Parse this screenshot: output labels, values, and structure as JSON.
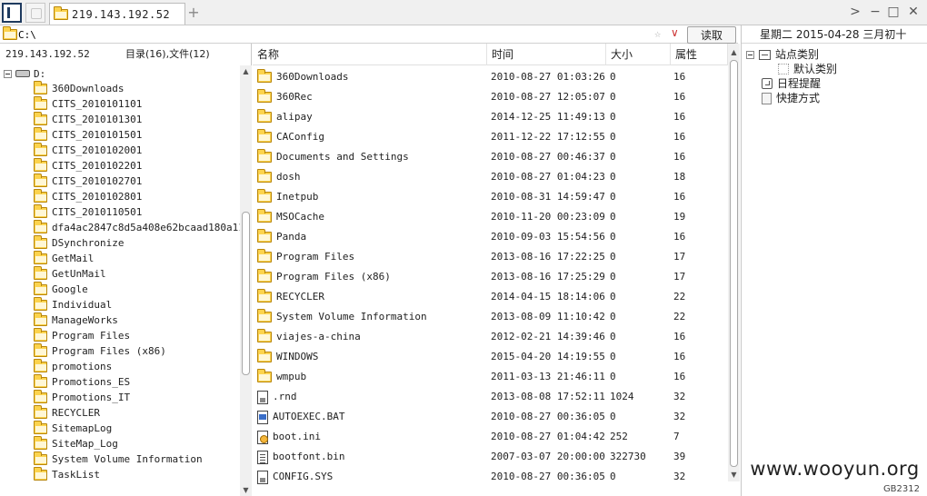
{
  "tabbar": {
    "tab_title": "219.143.192.52",
    "add_label": "+",
    "forward_label": ">",
    "minimize_label": "−",
    "maximize_label": "□",
    "close_label": "✕"
  },
  "address": {
    "value": "C:\\",
    "star_label": "☆",
    "dropdown_label": "∨",
    "read_button": "读取"
  },
  "left_panel": {
    "host": "219.143.192.52",
    "summary": "目录(16),文件(12)",
    "drive": "D:",
    "folders": [
      "360Downloads",
      "CITS_2010101101",
      "CITS_2010101301",
      "CITS_2010101501",
      "CITS_2010102001",
      "CITS_2010102201",
      "CITS_2010102701",
      "CITS_2010102801",
      "CITS_2010110501",
      "dfa4ac2847c8d5a408e62bcaad180a11",
      "DSynchronize",
      "GetMail",
      "GetUnMail",
      "Google",
      "Individual",
      "ManageWorks",
      "Program Files",
      "Program Files (x86)",
      "promotions",
      "Promotions_ES",
      "Promotions_IT",
      "RECYCLER",
      "SitemapLog",
      "SiteMap_Log",
      "System Volume Information",
      "TaskList"
    ]
  },
  "file_list": {
    "columns": {
      "name": "名称",
      "time": "时间",
      "size": "大小",
      "attr": "属性"
    },
    "rows": [
      {
        "name": "360Downloads",
        "time": "2010-08-27 01:03:26",
        "size": "0",
        "attr": "16",
        "icon": "folder-icon"
      },
      {
        "name": "360Rec",
        "time": "2010-08-27 12:05:07",
        "size": "0",
        "attr": "16",
        "icon": "folder-icon"
      },
      {
        "name": "alipay",
        "time": "2014-12-25 11:49:13",
        "size": "0",
        "attr": "16",
        "icon": "folder-icon"
      },
      {
        "name": "CAConfig",
        "time": "2011-12-22 17:12:55",
        "size": "0",
        "attr": "16",
        "icon": "folder-icon"
      },
      {
        "name": "Documents and Settings",
        "time": "2010-08-27 00:46:37",
        "size": "0",
        "attr": "16",
        "icon": "folder-icon"
      },
      {
        "name": "dosh",
        "time": "2010-08-27 01:04:23",
        "size": "0",
        "attr": "18",
        "icon": "folder-icon"
      },
      {
        "name": "Inetpub",
        "time": "2010-08-31 14:59:47",
        "size": "0",
        "attr": "16",
        "icon": "folder-icon"
      },
      {
        "name": "MSOCache",
        "time": "2010-11-20 00:23:09",
        "size": "0",
        "attr": "19",
        "icon": "folder-icon"
      },
      {
        "name": "Panda",
        "time": "2010-09-03 15:54:56",
        "size": "0",
        "attr": "16",
        "icon": "folder-icon"
      },
      {
        "name": "Program Files",
        "time": "2013-08-16 17:22:25",
        "size": "0",
        "attr": "17",
        "icon": "folder-icon"
      },
      {
        "name": "Program Files (x86)",
        "time": "2013-08-16 17:25:29",
        "size": "0",
        "attr": "17",
        "icon": "folder-icon"
      },
      {
        "name": "RECYCLER",
        "time": "2014-04-15 18:14:06",
        "size": "0",
        "attr": "22",
        "icon": "folder-icon"
      },
      {
        "name": "System Volume Information",
        "time": "2013-08-09 11:10:42",
        "size": "0",
        "attr": "22",
        "icon": "folder-icon"
      },
      {
        "name": "viajes-a-china",
        "time": "2012-02-21 14:39:46",
        "size": "0",
        "attr": "16",
        "icon": "folder-icon"
      },
      {
        "name": "WINDOWS",
        "time": "2015-04-20 14:19:55",
        "size": "0",
        "attr": "16",
        "icon": "folder-icon"
      },
      {
        "name": "wmpub",
        "time": "2011-03-13 21:46:11",
        "size": "0",
        "attr": "16",
        "icon": "folder-icon"
      },
      {
        "name": ".rnd",
        "time": "2013-08-08 17:52:11",
        "size": "1024",
        "attr": "32",
        "icon": "system-file-icon"
      },
      {
        "name": "AUTOEXEC.BAT",
        "time": "2010-08-27 00:36:05",
        "size": "0",
        "attr": "32",
        "icon": "batch-file-icon"
      },
      {
        "name": "boot.ini",
        "time": "2010-08-27 01:04:42",
        "size": "252",
        "attr": "7",
        "icon": "config-file-icon"
      },
      {
        "name": "bootfont.bin",
        "time": "2007-03-07 20:00:00",
        "size": "322730",
        "attr": "39",
        "icon": "text-file-icon"
      },
      {
        "name": "CONFIG.SYS",
        "time": "2010-08-27 00:36:05",
        "size": "0",
        "attr": "32",
        "icon": "system-file-icon"
      }
    ]
  },
  "right_panel": {
    "date": "星期二 2015-04-28 三月初十",
    "tree": {
      "site_category": "站点类别",
      "default_category": "默认类别",
      "reminder": "日程提醒",
      "shortcut": "快捷方式"
    },
    "watermark": "www.wooyun.org",
    "encoding": "GB2312"
  }
}
